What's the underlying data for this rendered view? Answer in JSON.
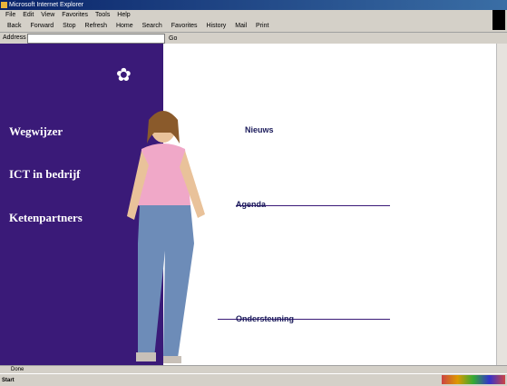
{
  "window": {
    "title": "Microsoft Internet Explorer"
  },
  "menubar": {
    "items": [
      "File",
      "Edit",
      "View",
      "Favorites",
      "Tools",
      "Help"
    ]
  },
  "toolbar": {
    "items": [
      "Back",
      "Forward",
      "Stop",
      "Refresh",
      "Home",
      "Search",
      "Favorites",
      "History",
      "Mail",
      "Print"
    ]
  },
  "address": {
    "label": "Address",
    "value": "",
    "go_label": "Go"
  },
  "nav": {
    "items": [
      {
        "title": "Wegwijzer"
      },
      {
        "title": "ICT in bedrijf"
      },
      {
        "title": "Ketenpartners"
      }
    ]
  },
  "content": {
    "section1": {
      "title": "Nieuws"
    },
    "section2": {
      "title": "Agenda"
    },
    "section3": {
      "title": "Ondersteuning"
    }
  },
  "statusbar": {
    "text": "Done"
  },
  "taskbar": {
    "start_label": "Start"
  },
  "colors": {
    "brand": "#3a1a78",
    "accent": "#e9b33a"
  }
}
